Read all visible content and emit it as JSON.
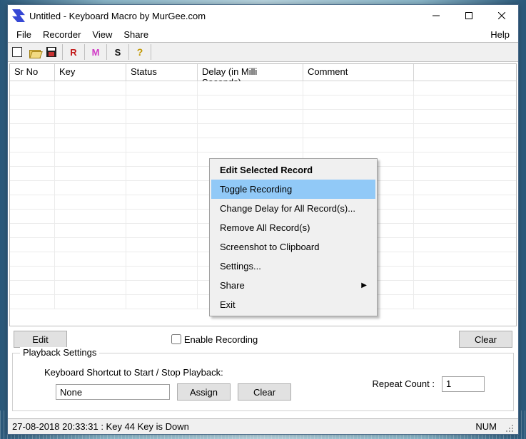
{
  "title": "Untitled - Keyboard Macro by MurGee.com",
  "menus": {
    "file": "File",
    "recorder": "Recorder",
    "view": "View",
    "share": "Share",
    "help": "Help"
  },
  "toolbar_letters": {
    "r": "R",
    "m": "M",
    "s": "S",
    "q": "?"
  },
  "columns": {
    "srno": "Sr No",
    "key": "Key",
    "status": "Status",
    "delay": "Delay (in Milli Seconds)",
    "comment": "Comment"
  },
  "midbar": {
    "edit": "Edit",
    "enable": "Enable Recording",
    "clear": "Clear"
  },
  "playback": {
    "legend": "Playback Settings",
    "shortcut_label": "Keyboard Shortcut to Start / Stop Playback:",
    "shortcut_value": "None",
    "assign": "Assign",
    "clear": "Clear",
    "repeat_label": "Repeat Count :",
    "repeat_value": "1"
  },
  "status": {
    "left": "27-08-2018 20:33:31 : Key 44 Key is Down",
    "num": "NUM"
  },
  "context": {
    "title": "Edit Selected Record",
    "items": [
      {
        "label": "Toggle Recording",
        "hl": true
      },
      {
        "label": "Change Delay for All Record(s)..."
      },
      {
        "label": "Remove All Record(s)"
      },
      {
        "label": "Screenshot to Clipboard"
      },
      {
        "label": "Settings..."
      },
      {
        "label": "Share",
        "sub": true
      },
      {
        "label": "Exit"
      }
    ]
  }
}
